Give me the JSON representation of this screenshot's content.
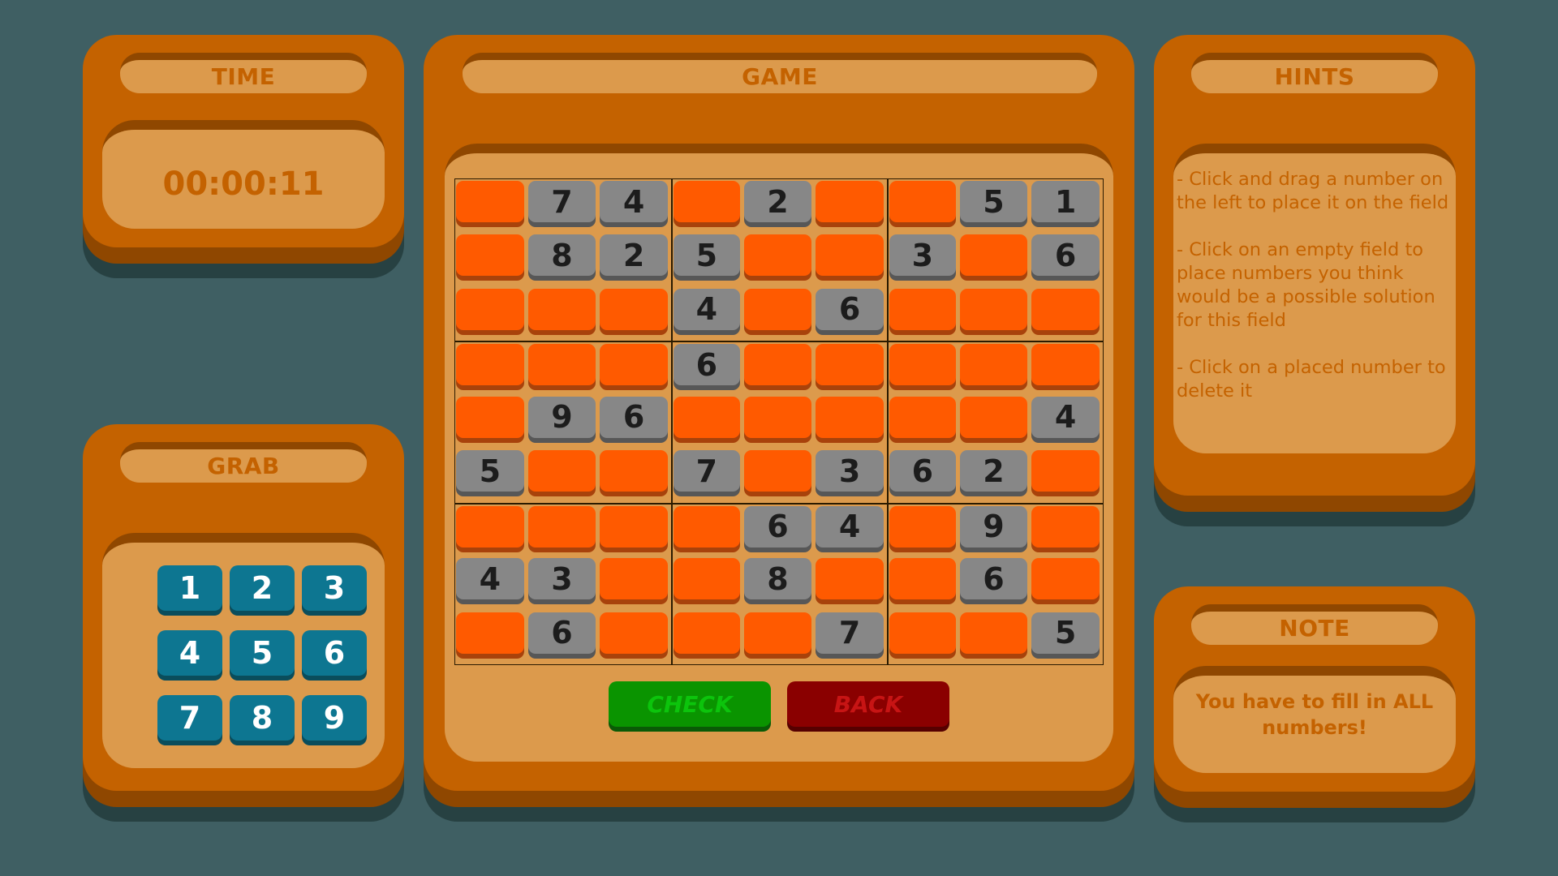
{
  "time": {
    "title": "TIME",
    "value": "00:00:11"
  },
  "grab": {
    "title": "GRAB",
    "numbers": [
      "1",
      "2",
      "3",
      "4",
      "5",
      "6",
      "7",
      "8",
      "9"
    ]
  },
  "game": {
    "title": "GAME",
    "board": [
      [
        "",
        "7",
        "4",
        "",
        "2",
        "",
        "",
        "5",
        "1"
      ],
      [
        "",
        "8",
        "2",
        "5",
        "",
        "",
        "3",
        "",
        "6"
      ],
      [
        "",
        "",
        "",
        "4",
        "",
        "6",
        "",
        "",
        ""
      ],
      [
        "",
        "",
        "",
        "6",
        "",
        "",
        "",
        "",
        ""
      ],
      [
        "",
        "9",
        "6",
        "",
        "",
        "",
        "",
        "",
        "4"
      ],
      [
        "5",
        "",
        "",
        "7",
        "",
        "3",
        "6",
        "2",
        ""
      ],
      [
        "",
        "",
        "",
        "",
        "6",
        "4",
        "",
        "9",
        ""
      ],
      [
        "4",
        "3",
        "",
        "",
        "8",
        "",
        "",
        "6",
        ""
      ],
      [
        "",
        "6",
        "",
        "",
        "",
        "7",
        "",
        "",
        "5"
      ]
    ],
    "check_label": "CHECK",
    "back_label": "BACK"
  },
  "hints": {
    "title": "HINTS",
    "items": [
      "- Click and drag a number on the left to place it on the field",
      "- Click on an empty field to place numbers you think would be a possible solution for this field",
      "- Click on a placed number to delete it"
    ]
  },
  "note": {
    "title": "NOTE",
    "text": "You have to fill in ALL numbers!"
  },
  "colors": {
    "background": "#3f5f63",
    "panel": "#c46200",
    "panel_inset": "#dc9a4c",
    "empty_cell": "#ff5a00",
    "given_cell": "#878787",
    "grab_button": "#0d7691",
    "check_button": "#0a9400",
    "back_button": "#8a0000"
  }
}
